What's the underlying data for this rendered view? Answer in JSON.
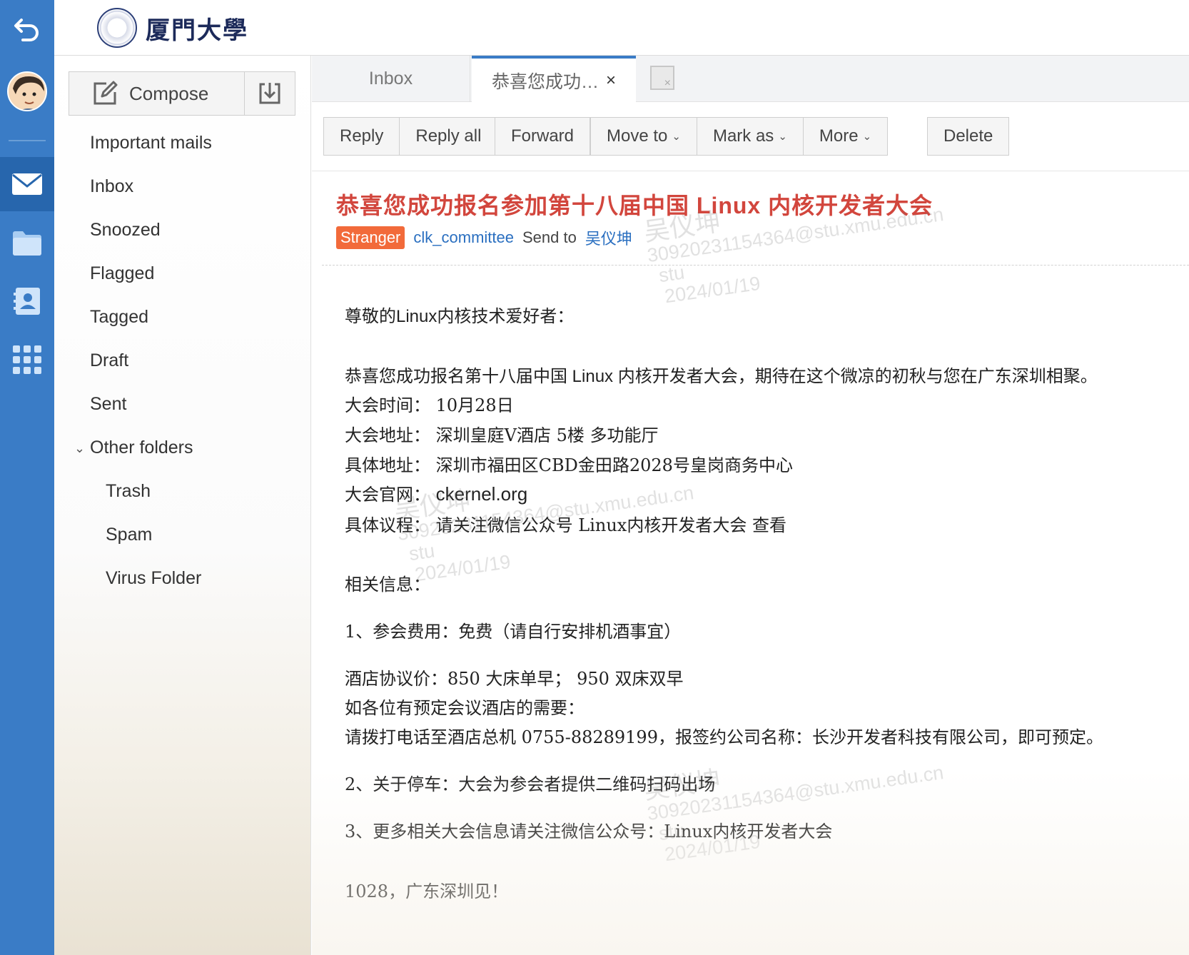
{
  "brand": {
    "logo_text": "厦門大學"
  },
  "rail": {
    "icons": [
      "back-icon",
      "avatar",
      "mail-icon",
      "folder-icon",
      "contacts-icon",
      "apps-grid-icon"
    ]
  },
  "compose": {
    "label": "Compose"
  },
  "folders": {
    "important": "Important mails",
    "inbox": "Inbox",
    "snoozed": "Snoozed",
    "flagged": "Flagged",
    "tagged": "Tagged",
    "draft": "Draft",
    "sent": "Sent",
    "other": "Other folders",
    "trash": "Trash",
    "spam": "Spam",
    "virus": "Virus Folder"
  },
  "tabs": {
    "inbox": "Inbox",
    "active": "恭喜您成功…",
    "close": "×"
  },
  "toolbar": {
    "reply": "Reply",
    "reply_all": "Reply all",
    "forward": "Forward",
    "move_to": "Move to",
    "mark_as": "Mark as",
    "more": "More",
    "delete": "Delete",
    "chevron": "⌄"
  },
  "message": {
    "subject": "恭喜您成功报名参加第十八届中国 Linux 内核开发者大会",
    "badge": "Stranger",
    "sender": "clk_committee",
    "send_to_label": "Send to",
    "recipient": "吴仪坤",
    "lines": {
      "greeting": "尊敬的Linux内核技术爱好者：",
      "intro": "恭喜您成功报名第十八届中国 Linux 内核开发者大会，期待在这个微凉的初秋与您在广东深圳相聚。",
      "time": "大会时间：  10月28日",
      "venue": "大会地址：  深圳皇庭V酒店 5楼 多功能厅",
      "address": "具体地址：  深圳市福田区CBD金田路2028号皇岗商务中心",
      "website_label": "大会官网：",
      "website": "ckernel.org",
      "agenda": "具体议程：  请关注微信公众号 Linux内核开发者大会 查看",
      "related": "相关信息：",
      "fee": "1、参会费用：免费（请自行安排机酒事宜）",
      "hotel_price": "酒店协议价：850 大床单早；  950 双床双早",
      "hotel_need": "如各位有预定会议酒店的需要：",
      "hotel_call": "请拨打电话至酒店总机 0755-88289199，报签约公司名称：长沙开发者科技有限公司，即可预定。",
      "parking": "2、关于停车：大会为参会者提供二维码扫码出场",
      "more_info": "3、更多相关大会信息请关注微信公众号：Linux内核开发者大会",
      "closing": "1028，广东深圳见！"
    }
  },
  "watermark": {
    "name": "吴仪坤",
    "id_email": "30920231154364@stu.xmu.edu.cn",
    "role": "stu",
    "date": "2024/01/19"
  }
}
